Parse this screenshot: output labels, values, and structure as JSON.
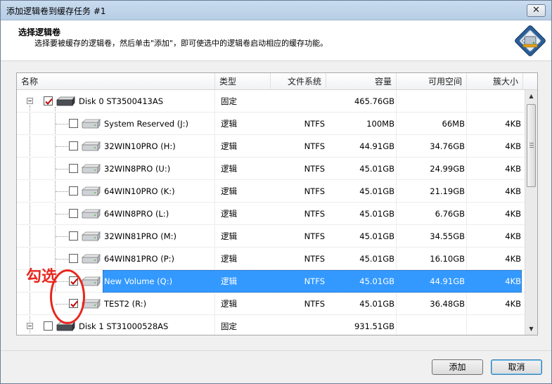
{
  "window": {
    "title": "添加逻辑卷到缓存任务 #1",
    "close_label": "✕"
  },
  "header": {
    "title": "选择逻辑卷",
    "description": "选择要被缓存的逻辑卷，然后单击\"添加\"，即可使选中的逻辑卷启动相应的缓存功能。",
    "icon": "cache-drive-icon"
  },
  "columns": [
    "名称",
    "类型",
    "文件系统",
    "容量",
    "可用空间",
    "簇大小"
  ],
  "rows": [
    {
      "name": "Disk 0 ST3500413AS",
      "type": "固定",
      "fs": "",
      "capacity": "465.76GB",
      "free": "",
      "cluster": "",
      "checked": true,
      "level": 0,
      "selected": false
    },
    {
      "name": "System Reserved (J:)",
      "type": "逻辑",
      "fs": "NTFS",
      "capacity": "100MB",
      "free": "66MB",
      "cluster": "4KB",
      "checked": false,
      "level": 1,
      "selected": false
    },
    {
      "name": "32WIN10PRO (H:)",
      "type": "逻辑",
      "fs": "NTFS",
      "capacity": "44.91GB",
      "free": "34.76GB",
      "cluster": "4KB",
      "checked": false,
      "level": 1,
      "selected": false
    },
    {
      "name": "32WIN8PRO (U:)",
      "type": "逻辑",
      "fs": "NTFS",
      "capacity": "45.01GB",
      "free": "24.99GB",
      "cluster": "4KB",
      "checked": false,
      "level": 1,
      "selected": false
    },
    {
      "name": "64WIN10PRO (K:)",
      "type": "逻辑",
      "fs": "NTFS",
      "capacity": "45.01GB",
      "free": "21.19GB",
      "cluster": "4KB",
      "checked": false,
      "level": 1,
      "selected": false
    },
    {
      "name": "64WIN8PRO (L:)",
      "type": "逻辑",
      "fs": "NTFS",
      "capacity": "45.01GB",
      "free": "6.76GB",
      "cluster": "4KB",
      "checked": false,
      "level": 1,
      "selected": false
    },
    {
      "name": "32WIN81PRO (M:)",
      "type": "逻辑",
      "fs": "NTFS",
      "capacity": "45.01GB",
      "free": "34.55GB",
      "cluster": "4KB",
      "checked": false,
      "level": 1,
      "selected": false
    },
    {
      "name": "64WIN81PRO (P:)",
      "type": "逻辑",
      "fs": "NTFS",
      "capacity": "45.01GB",
      "free": "16.10GB",
      "cluster": "4KB",
      "checked": false,
      "level": 1,
      "selected": false
    },
    {
      "name": "New Volume (Q:)",
      "type": "逻辑",
      "fs": "NTFS",
      "capacity": "45.01GB",
      "free": "44.91GB",
      "cluster": "4KB",
      "checked": true,
      "level": 1,
      "selected": true
    },
    {
      "name": "TEST2 (R:)",
      "type": "逻辑",
      "fs": "NTFS",
      "capacity": "45.01GB",
      "free": "36.48GB",
      "cluster": "4KB",
      "checked": true,
      "level": 1,
      "selected": false
    },
    {
      "name": "Disk 1 ST31000528AS",
      "type": "固定",
      "fs": "",
      "capacity": "931.51GB",
      "free": "",
      "cluster": "",
      "checked": false,
      "level": 0,
      "selected": false
    }
  ],
  "annotation": {
    "text": "勾选",
    "color": "#e8261e"
  },
  "buttons": {
    "add": "添加",
    "cancel": "取消"
  },
  "colors": {
    "selection": "#3399ff",
    "check": "#c00000"
  }
}
